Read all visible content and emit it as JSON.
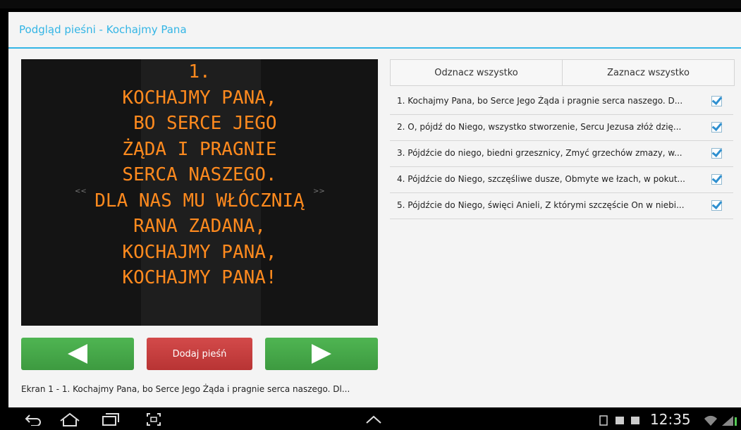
{
  "dialog": {
    "title": "Podgląd pieśni - Kochajmy Pana"
  },
  "preview": {
    "lyrics": "1.\nKOCHAJMY PANA,\n BO SERCE JEGO\nŻĄDA I PRAGNIE\nSERCA NASZEGO.\nDLA NAS MU WŁÓCZNIĄ\nRANA ZADANA,\nKOCHAJMY PANA,\nKOCHAJMY PANA!",
    "prev_hint": "<<",
    "next_hint": ">>",
    "text_color": "#ff8a1e"
  },
  "buttons": {
    "prev_icon": "left-triangle-icon",
    "add_label": "Dodaj pieśń",
    "next_icon": "right-triangle-icon"
  },
  "status": "Ekran 1 - 1. Kochajmy Pana, bo Serce Jego Żąda i pragnie serca naszego. Dl...",
  "tabs": {
    "deselect_all": "Odznacz wszystko",
    "select_all": "Zaznacz wszystko"
  },
  "verses": [
    {
      "text": "1. Kochajmy Pana, bo Serce Jego Żąda i pragnie serca naszego. D...",
      "checked": true
    },
    {
      "text": "2. O, pójdź do Niego, wszystko stworzenie, Sercu Jezusa złóż dzię...",
      "checked": true
    },
    {
      "text": "3. Pójdźcie do niego, biedni grzesznicy, Zmyć grzechów zmazy, w...",
      "checked": true
    },
    {
      "text": "4. Pójdźcie do Niego, szczęśliwe dusze, Obmyte we łzach, w pokut...",
      "checked": true
    },
    {
      "text": "5. Pójdźcie do Niego, święci Anieli, Z którymi szczęście On w niebi...",
      "checked": true
    }
  ],
  "systembar": {
    "time": "12:35",
    "icons": [
      "back-icon",
      "home-icon",
      "recent-apps-icon",
      "screenshot-icon",
      "up-chevron-icon",
      "notification-icons"
    ]
  },
  "colors": {
    "accent": "#33b5e5",
    "green": "#4caf50",
    "red": "#c43c3c"
  }
}
